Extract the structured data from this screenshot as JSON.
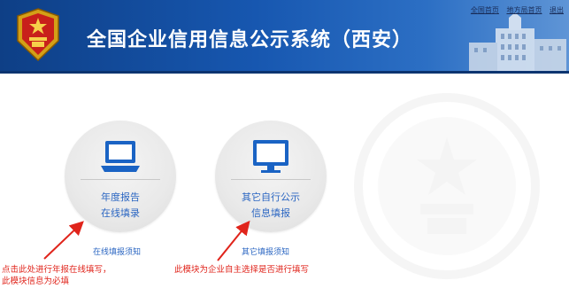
{
  "header": {
    "title": "全国企业信用信息公示系统（西安）",
    "links": [
      "全国首页",
      "地方局首页",
      "退出"
    ]
  },
  "modules": [
    {
      "line1": "年度报告",
      "line2": "在线填录",
      "notice": "在线填报须知",
      "icon": "laptop-icon"
    },
    {
      "line1": "其它自行公示",
      "line2": "信息填报",
      "notice": "其它填报须知",
      "icon": "monitor-icon"
    }
  ],
  "annotations": {
    "left": [
      "点击此处进行年报在线填写，",
      "此模块信息为必填"
    ],
    "right": "此模块为企业自主选择是否进行填写"
  },
  "colors": {
    "banner": "#1757b0",
    "link_blue": "#2b66c2",
    "annotation_red": "#e0241b",
    "icon_blue": "#1a63c4"
  }
}
